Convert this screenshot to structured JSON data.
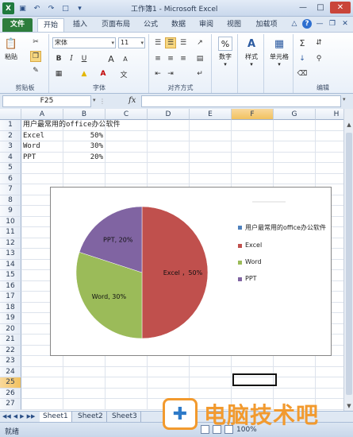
{
  "window": {
    "title": "工作簿1 - Microsoft Excel",
    "qat_icons": [
      "excel-icon",
      "save-icon",
      "undo-icon",
      "redo-icon",
      "new-icon"
    ],
    "controls": [
      "minimize",
      "maximize",
      "close"
    ]
  },
  "tabs": {
    "file": "文件",
    "items": [
      "开始",
      "插入",
      "页面布局",
      "公式",
      "数据",
      "审阅",
      "视图",
      "加载项"
    ],
    "active": "开始"
  },
  "ribbon": {
    "clipboard": {
      "paste": "粘贴",
      "label": "剪贴板"
    },
    "font": {
      "name": "宋体",
      "size": "11",
      "label": "字体",
      "bold": "B",
      "italic": "I",
      "underline": "U",
      "grow": "A",
      "shrink": "A"
    },
    "alignment": {
      "label": "对齐方式"
    },
    "number": {
      "button": "数字",
      "icon_text": "%"
    },
    "styles": {
      "button": "样式"
    },
    "cells": {
      "button": "单元格"
    },
    "editing": {
      "label": "编辑",
      "sum": "Σ"
    }
  },
  "formula_bar": {
    "name_box": "F25",
    "fx": "fx",
    "formula": ""
  },
  "grid": {
    "columns": [
      "A",
      "B",
      "C",
      "D",
      "E",
      "F",
      "G",
      "H"
    ],
    "active_column": "F",
    "active_row": 25,
    "rows": [
      1,
      2,
      3,
      4,
      5,
      6,
      7,
      8,
      9,
      10,
      11,
      12,
      13,
      14,
      15,
      16,
      17,
      18,
      19,
      20,
      21,
      22,
      23,
      24,
      25,
      26,
      27
    ],
    "cells": {
      "A1": "用户最常用的office办公软件",
      "A2": "Excel",
      "B2": "50%",
      "A3": "Word",
      "B3": "30%",
      "A4": "PPT",
      "B4": "20%"
    }
  },
  "chart_data": {
    "type": "pie",
    "categories": [
      "Excel",
      "Word",
      "PPT"
    ],
    "values": [
      50,
      30,
      20
    ],
    "data_labels": [
      "Excel ，50%",
      "Word, 30%",
      "PPT, 20%"
    ],
    "legend": [
      "用户最常用的office办公软件",
      "Excel",
      "Word",
      "PPT"
    ],
    "legend_position": "right",
    "colors": [
      "#c0504d",
      "#9bbb59",
      "#8064a2"
    ],
    "legend_colors": [
      "#4f81bd",
      "#c0504d",
      "#9bbb59",
      "#8064a2"
    ]
  },
  "sheets": {
    "tabs": [
      "Sheet1",
      "Sheet2",
      "Sheet3"
    ],
    "active": "Sheet1"
  },
  "status": {
    "text": "就绪",
    "zoom": "100%"
  },
  "watermark": {
    "text": "电脑技术吧"
  }
}
